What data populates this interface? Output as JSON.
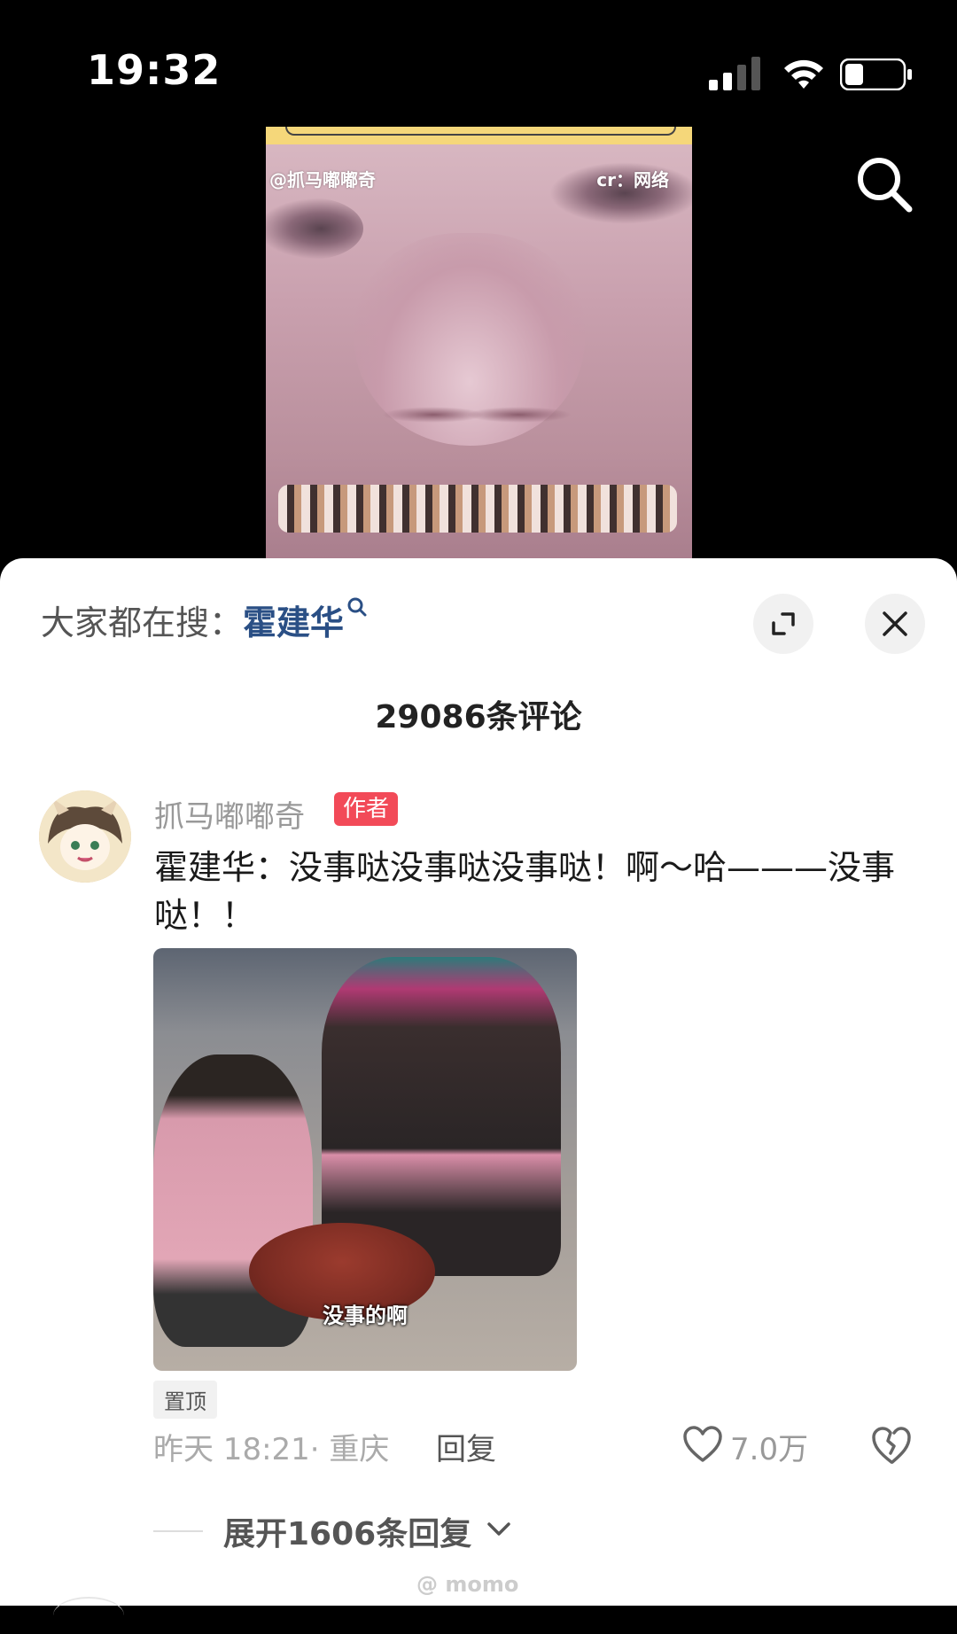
{
  "status_bar": {
    "time": "19:32"
  },
  "video": {
    "watermark": "@抓马嘟嘟奇",
    "credit": "cr：网络"
  },
  "sheet": {
    "trending_prefix": "大家都在搜：",
    "trending_term": "霍建华",
    "comment_count": "29086条评论"
  },
  "comment": {
    "username": "抓马嘟嘟奇",
    "author_badge": "作者",
    "text": "霍建华：没事哒没事哒没事哒！啊～哈———没事哒！！",
    "image_caption": "没事的啊",
    "pinned": "置顶",
    "time_location": "昨天 18:21· 重庆",
    "reply_label": "回复",
    "like_count": "7.0万",
    "expand_replies": "展开1606条回复"
  },
  "watermark_bottom": "@ momo",
  "colors": {
    "accent_link": "#2a4f85",
    "author_badge": "#f24a58"
  }
}
